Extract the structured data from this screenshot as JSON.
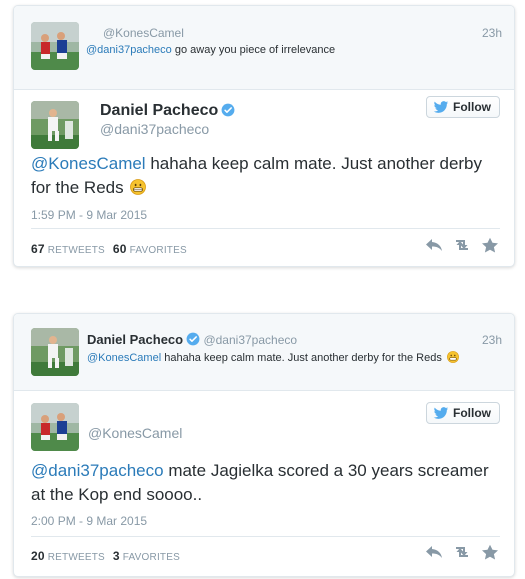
{
  "tweet1": {
    "parent": {
      "handle": "@KonesCamel",
      "time": "23h",
      "mention": "@dani37pacheco",
      "text": " go away you piece of irrelevance"
    },
    "main": {
      "name": "Daniel Pacheco",
      "handle": "@dani37pacheco",
      "follow_label": "Follow",
      "mention": "@KonesCamel",
      "text": " hahaha keep calm mate. Just another derby for the Reds",
      "timestamp": "1:59 PM - 9 Mar 2015",
      "retweets_count": "67",
      "retweets_label": "RETWEETS",
      "favorites_count": "60",
      "favorites_label": "FAVORITES"
    }
  },
  "tweet2": {
    "parent": {
      "name": "Daniel Pacheco",
      "handle": "@dani37pacheco",
      "time": "23h",
      "mention": "@KonesCamel",
      "text": " hahaha keep calm mate. Just another derby for the Reds"
    },
    "main": {
      "handle": "@KonesCamel",
      "follow_label": "Follow",
      "mention": "@dani37pacheco",
      "text": " mate Jagielka scored a 30 years screamer at the Kop end soooo..",
      "timestamp": "2:00 PM - 9 Mar 2015",
      "retweets_count": "20",
      "retweets_label": "RETWEETS",
      "favorites_count": "3",
      "favorites_label": "FAVORITES"
    }
  },
  "icons": [
    "verified-icon",
    "twitter-bird-icon",
    "reply-icon",
    "retweet-icon",
    "favorite-star-icon",
    "grinning-emoji-icon"
  ],
  "colors": {
    "link": "#2b7bb9",
    "muted": "#8899a6",
    "verified": "#55acee",
    "text": "#292f33"
  }
}
